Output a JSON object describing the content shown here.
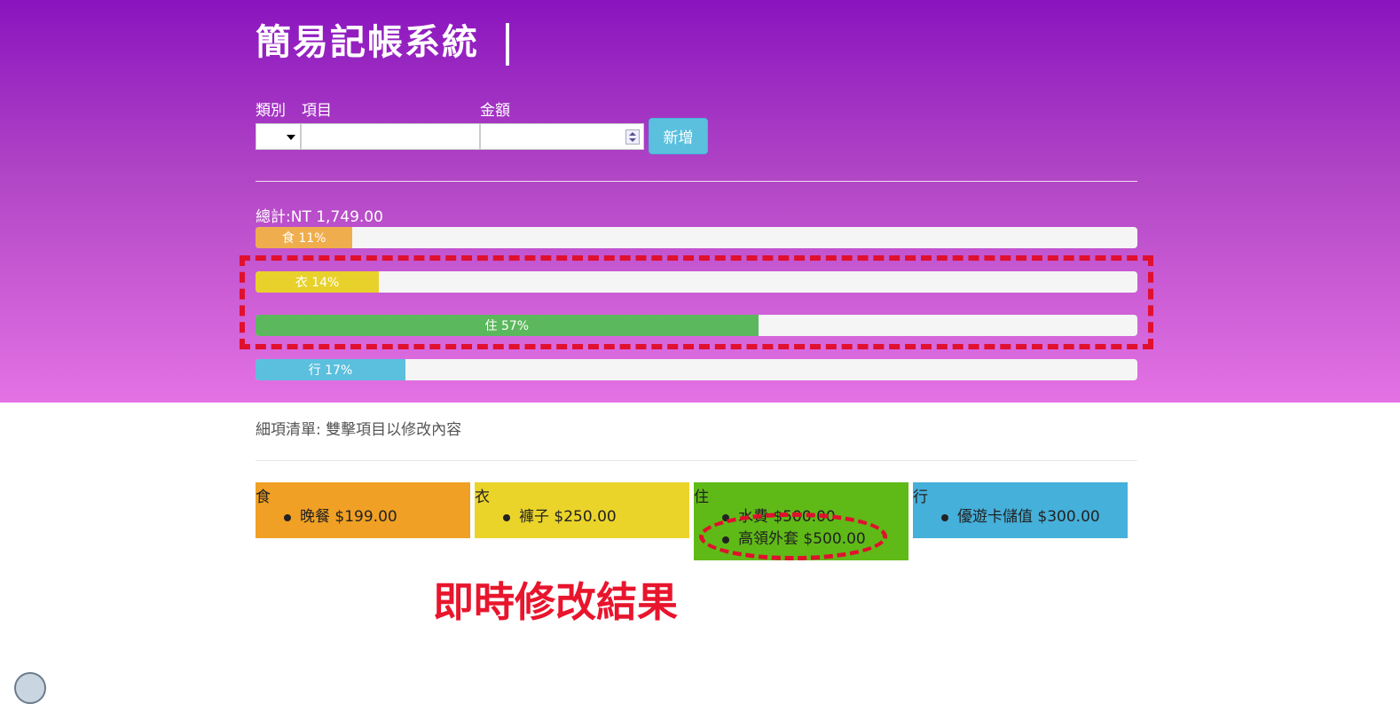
{
  "app": {
    "title": "簡易記帳系統"
  },
  "form": {
    "category_label": "類別",
    "item_label": "項目",
    "amount_label": "金額",
    "category_value": "",
    "item_value": "",
    "amount_value": "",
    "add_button": "新增"
  },
  "summary": {
    "total_text": "總計:NT 1,749.00",
    "bars": [
      {
        "label": "食 11%",
        "percent": 11,
        "color": "#f0ad4e"
      },
      {
        "label": "衣 14%",
        "percent": 14,
        "color": "#e8d12a"
      },
      {
        "label": "住 57%",
        "percent": 57,
        "color": "#5cb85c"
      },
      {
        "label": "行 17%",
        "percent": 17,
        "color": "#5bc0de"
      }
    ]
  },
  "details": {
    "title": "細項清單: 雙擊項目以修改內容",
    "categories": [
      {
        "name": "食",
        "color": "#f0a024",
        "items": [
          "晚餐 $199.00"
        ]
      },
      {
        "name": "衣",
        "color": "#ebd42a",
        "items": [
          "褲子 $250.00"
        ]
      },
      {
        "name": "住",
        "color": "#5fba17",
        "items": [
          "水費 $500.00",
          "高領外套 $500.00"
        ]
      },
      {
        "name": "行",
        "color": "#45b0da",
        "items": [
          "優遊卡儲值 $300.00"
        ]
      }
    ]
  },
  "annotation": {
    "result_label": "即時修改結果",
    "mark_color": "#e0102e"
  }
}
